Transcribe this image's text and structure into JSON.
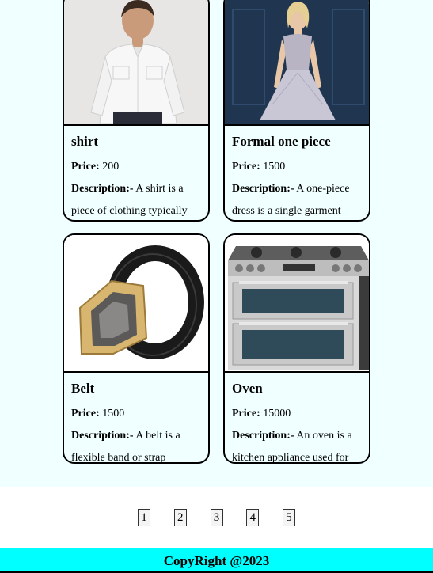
{
  "products": [
    {
      "title": "shirt",
      "price_label": "Price:",
      "price": "200",
      "desc_label": "Description:-",
      "desc": "A shirt is a piece of clothing typically",
      "icon": "shirt-photo"
    },
    {
      "title": "Formal one piece",
      "price_label": "Price:",
      "price": "1500",
      "desc_label": "Description:-",
      "desc": "A one-piece dress is a single garment",
      "icon": "dress-photo"
    },
    {
      "title": "Belt",
      "price_label": "Price:",
      "price": "1500",
      "desc_label": "Description:-",
      "desc": "A belt is a flexible band or strap",
      "icon": "belt-photo"
    },
    {
      "title": "Oven",
      "price_label": "Price:",
      "price": "15000",
      "desc_label": "Description:-",
      "desc": "An oven is a kitchen appliance used for",
      "icon": "oven-photo"
    }
  ],
  "pagination": [
    "1",
    "2",
    "3",
    "4",
    "5"
  ],
  "footer": {
    "text": "CopyRight @2023"
  },
  "colors": {
    "footer_bg": "#00ffff",
    "panel_bg": "#f0ffff"
  }
}
